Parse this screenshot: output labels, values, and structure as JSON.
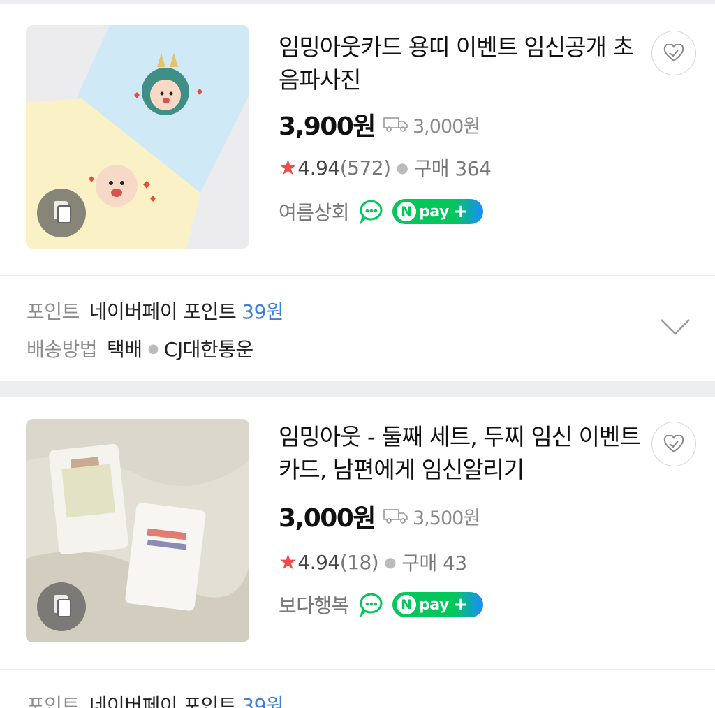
{
  "products": [
    {
      "title": "임밍아웃카드 용띠 이벤트 임신공개 초음파사진",
      "price": "3,900원",
      "shipping": "3,000원",
      "rating": "4.94",
      "review_count": "(572)",
      "purchases": "구매 364",
      "seller": "여름상회",
      "icons": [
        "wishlist-heart-icon",
        "truck-icon",
        "talk-icon",
        "npay-plus-badge",
        "copy-images-icon"
      ],
      "extra": {
        "point_label": "포인트",
        "point_text": "네이버페이 포인트",
        "point_value": "39원",
        "delivery_label": "배송방법",
        "delivery_method": "택배",
        "courier": "CJ대한통운"
      }
    },
    {
      "title": "임밍아웃 - 둘째 세트, 두찌 임신 이벤트 카드, 남편에게 임신알리기",
      "price": "3,000원",
      "shipping": "3,500원",
      "rating": "4.94",
      "review_count": "(18)",
      "purchases": "구매 43",
      "seller": "보다행복",
      "icons": [
        "wishlist-heart-icon",
        "truck-icon",
        "talk-icon",
        "npay-plus-badge",
        "copy-images-icon"
      ],
      "extra": {
        "point_label": "포인트",
        "point_text": "네이버페이 포인트",
        "point_value": "39원"
      }
    }
  ],
  "npay": {
    "n": "N",
    "pay": "pay",
    "plus": "+"
  },
  "star_glyph": "★",
  "colors": {
    "star": "#f04a4a",
    "point_blue": "#3d7fd8",
    "npay_green": "#03c75a",
    "npay_blue": "#1a8cff"
  }
}
